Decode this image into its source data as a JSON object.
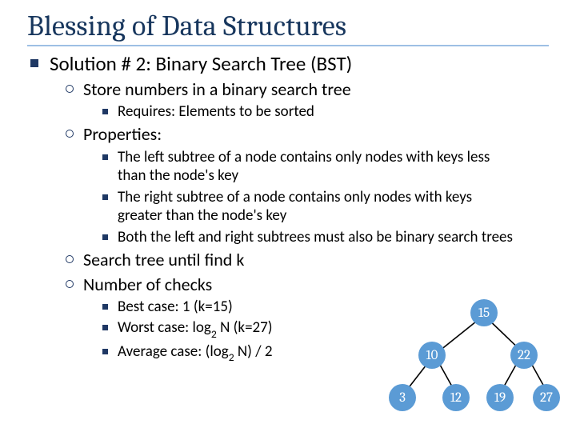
{
  "title": "Blessing of Data Structures",
  "heading": "Solution # 2: Binary Search Tree (BST)",
  "store": "Store numbers in a binary search tree",
  "store_sub1": "Requires:  Elements to be sorted",
  "properties": "Properties:",
  "prop1": "The left subtree of a node contains only nodes with keys less than the node's key",
  "prop2": "The right subtree of a node contains only nodes with keys greater than the node's key",
  "prop3": "Both the left and right subtrees must also be binary search trees",
  "search": "Search tree until find k",
  "checks": "Number of checks",
  "case_best_pre": "Best case: 1 (k=15)",
  "case_worst_pre": "Worst case: log",
  "case_worst_post": " N (k=27)",
  "case_avg_pre": "Average case: (log",
  "case_avg_post": " N) / 2",
  "sub2": "2",
  "tree": {
    "n15": "15",
    "n10": "10",
    "n22": "22",
    "n3": "3",
    "n12": "12",
    "n19": "19",
    "n27": "27"
  }
}
